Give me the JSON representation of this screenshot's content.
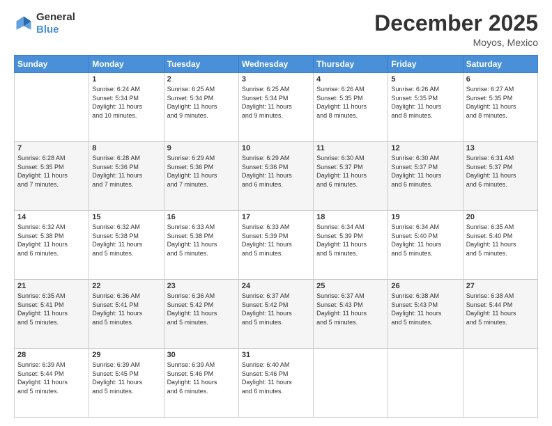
{
  "logo": {
    "line1": "General",
    "line2": "Blue"
  },
  "title": "December 2025",
  "subtitle": "Moyos, Mexico",
  "days_of_week": [
    "Sunday",
    "Monday",
    "Tuesday",
    "Wednesday",
    "Thursday",
    "Friday",
    "Saturday"
  ],
  "weeks": [
    [
      {
        "day": "",
        "info": ""
      },
      {
        "day": "1",
        "info": "Sunrise: 6:24 AM\nSunset: 5:34 PM\nDaylight: 11 hours\nand 10 minutes."
      },
      {
        "day": "2",
        "info": "Sunrise: 6:25 AM\nSunset: 5:34 PM\nDaylight: 11 hours\nand 9 minutes."
      },
      {
        "day": "3",
        "info": "Sunrise: 6:25 AM\nSunset: 5:34 PM\nDaylight: 11 hours\nand 9 minutes."
      },
      {
        "day": "4",
        "info": "Sunrise: 6:26 AM\nSunset: 5:35 PM\nDaylight: 11 hours\nand 8 minutes."
      },
      {
        "day": "5",
        "info": "Sunrise: 6:26 AM\nSunset: 5:35 PM\nDaylight: 11 hours\nand 8 minutes."
      },
      {
        "day": "6",
        "info": "Sunrise: 6:27 AM\nSunset: 5:35 PM\nDaylight: 11 hours\nand 8 minutes."
      }
    ],
    [
      {
        "day": "7",
        "info": "Sunrise: 6:28 AM\nSunset: 5:35 PM\nDaylight: 11 hours\nand 7 minutes."
      },
      {
        "day": "8",
        "info": "Sunrise: 6:28 AM\nSunset: 5:36 PM\nDaylight: 11 hours\nand 7 minutes."
      },
      {
        "day": "9",
        "info": "Sunrise: 6:29 AM\nSunset: 5:36 PM\nDaylight: 11 hours\nand 7 minutes."
      },
      {
        "day": "10",
        "info": "Sunrise: 6:29 AM\nSunset: 5:36 PM\nDaylight: 11 hours\nand 6 minutes."
      },
      {
        "day": "11",
        "info": "Sunrise: 6:30 AM\nSunset: 5:37 PM\nDaylight: 11 hours\nand 6 minutes."
      },
      {
        "day": "12",
        "info": "Sunrise: 6:30 AM\nSunset: 5:37 PM\nDaylight: 11 hours\nand 6 minutes."
      },
      {
        "day": "13",
        "info": "Sunrise: 6:31 AM\nSunset: 5:37 PM\nDaylight: 11 hours\nand 6 minutes."
      }
    ],
    [
      {
        "day": "14",
        "info": "Sunrise: 6:32 AM\nSunset: 5:38 PM\nDaylight: 11 hours\nand 6 minutes."
      },
      {
        "day": "15",
        "info": "Sunrise: 6:32 AM\nSunset: 5:38 PM\nDaylight: 11 hours\nand 5 minutes."
      },
      {
        "day": "16",
        "info": "Sunrise: 6:33 AM\nSunset: 5:38 PM\nDaylight: 11 hours\nand 5 minutes."
      },
      {
        "day": "17",
        "info": "Sunrise: 6:33 AM\nSunset: 5:39 PM\nDaylight: 11 hours\nand 5 minutes."
      },
      {
        "day": "18",
        "info": "Sunrise: 6:34 AM\nSunset: 5:39 PM\nDaylight: 11 hours\nand 5 minutes."
      },
      {
        "day": "19",
        "info": "Sunrise: 6:34 AM\nSunset: 5:40 PM\nDaylight: 11 hours\nand 5 minutes."
      },
      {
        "day": "20",
        "info": "Sunrise: 6:35 AM\nSunset: 5:40 PM\nDaylight: 11 hours\nand 5 minutes."
      }
    ],
    [
      {
        "day": "21",
        "info": "Sunrise: 6:35 AM\nSunset: 5:41 PM\nDaylight: 11 hours\nand 5 minutes."
      },
      {
        "day": "22",
        "info": "Sunrise: 6:36 AM\nSunset: 5:41 PM\nDaylight: 11 hours\nand 5 minutes."
      },
      {
        "day": "23",
        "info": "Sunrise: 6:36 AM\nSunset: 5:42 PM\nDaylight: 11 hours\nand 5 minutes."
      },
      {
        "day": "24",
        "info": "Sunrise: 6:37 AM\nSunset: 5:42 PM\nDaylight: 11 hours\nand 5 minutes."
      },
      {
        "day": "25",
        "info": "Sunrise: 6:37 AM\nSunset: 5:43 PM\nDaylight: 11 hours\nand 5 minutes."
      },
      {
        "day": "26",
        "info": "Sunrise: 6:38 AM\nSunset: 5:43 PM\nDaylight: 11 hours\nand 5 minutes."
      },
      {
        "day": "27",
        "info": "Sunrise: 6:38 AM\nSunset: 5:44 PM\nDaylight: 11 hours\nand 5 minutes."
      }
    ],
    [
      {
        "day": "28",
        "info": "Sunrise: 6:39 AM\nSunset: 5:44 PM\nDaylight: 11 hours\nand 5 minutes."
      },
      {
        "day": "29",
        "info": "Sunrise: 6:39 AM\nSunset: 5:45 PM\nDaylight: 11 hours\nand 5 minutes."
      },
      {
        "day": "30",
        "info": "Sunrise: 6:39 AM\nSunset: 5:46 PM\nDaylight: 11 hours\nand 6 minutes."
      },
      {
        "day": "31",
        "info": "Sunrise: 6:40 AM\nSunset: 5:46 PM\nDaylight: 11 hours\nand 6 minutes."
      },
      {
        "day": "",
        "info": ""
      },
      {
        "day": "",
        "info": ""
      },
      {
        "day": "",
        "info": ""
      }
    ]
  ]
}
